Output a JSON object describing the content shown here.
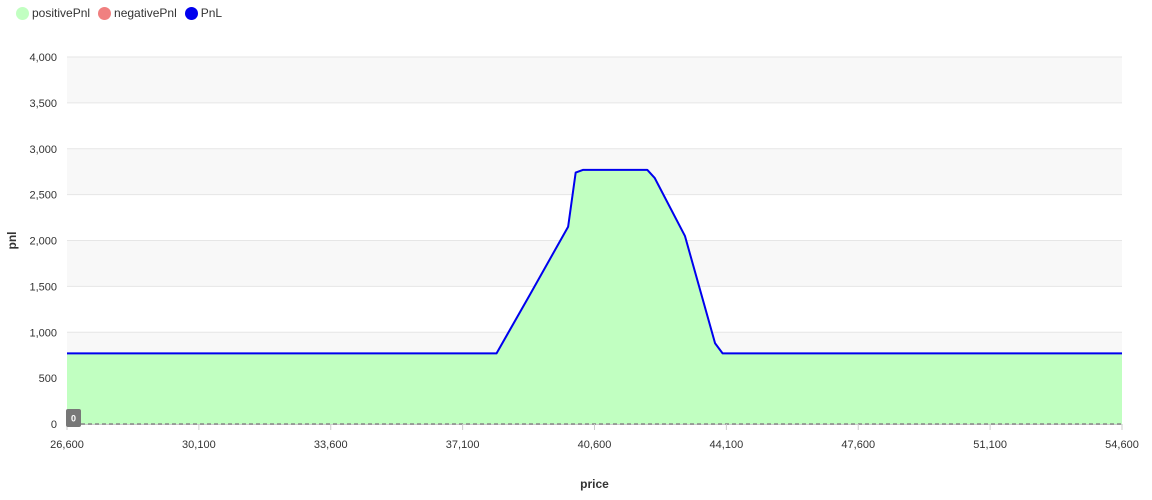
{
  "chart_data": {
    "type": "area",
    "legend": {
      "placement": "top-left",
      "items": [
        {
          "name": "positivePnl",
          "color": "#c1ffc1"
        },
        {
          "name": "negativePnl",
          "color": "#f08080"
        },
        {
          "name": "PnL",
          "color": "#0000ee"
        }
      ]
    },
    "xlabel": "price",
    "ylabel": "pnl",
    "xlim": [
      26600,
      54600
    ],
    "ylim": [
      0,
      4000
    ],
    "x_ticks": [
      "26,600",
      "30,100",
      "33,600",
      "37,100",
      "40,600",
      "44,100",
      "47,600",
      "51,100",
      "54,600"
    ],
    "y_ticks": [
      "0",
      "500",
      "1,000",
      "1,500",
      "2,000",
      "2,500",
      "3,000",
      "3,500",
      "4,000"
    ],
    "x_tick_values": [
      26600,
      30100,
      33600,
      37100,
      40600,
      44100,
      47600,
      51100,
      54600
    ],
    "y_tick_values": [
      0,
      500,
      1000,
      1500,
      2000,
      2500,
      3000,
      3500,
      4000
    ],
    "grid": true,
    "zero_line_label": "0",
    "series": [
      {
        "name": "PnL",
        "color": "#0000ee",
        "fill_positive": "#c1ffc1",
        "fill_negative": "#f08080",
        "x": [
          26600,
          38000,
          38900,
          39900,
          40100,
          40300,
          42000,
          42200,
          43000,
          43800,
          44000,
          54600
        ],
        "y": [
          770,
          770,
          1420,
          2150,
          2740,
          2770,
          2770,
          2680,
          2050,
          880,
          770,
          770
        ]
      }
    ],
    "colors": {
      "band": "#f8f8f8",
      "gridline": "#e6e6e6",
      "axis": "#cccccc",
      "zero_line": "#888888",
      "badge": "#777777"
    }
  }
}
